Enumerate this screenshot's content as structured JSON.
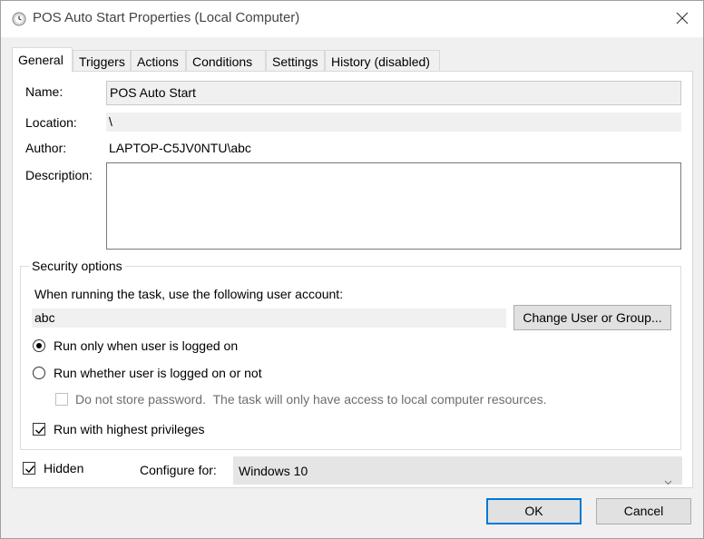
{
  "window": {
    "title": "POS Auto Start Properties (Local Computer)",
    "icon": "task-scheduler-clock-icon",
    "close_icon": "close-icon"
  },
  "tabs": [
    {
      "label": "General",
      "active": true
    },
    {
      "label": "Triggers"
    },
    {
      "label": "Actions"
    },
    {
      "label": "Conditions"
    },
    {
      "label": "Settings"
    },
    {
      "label": "History (disabled)"
    }
  ],
  "general": {
    "name_label": "Name:",
    "name_value": "POS Auto Start",
    "location_label": "Location:",
    "location_value": "\\",
    "author_label": "Author:",
    "author_value": "LAPTOP-C5JV0NTU\\abc",
    "description_label": "Description:",
    "description_value": ""
  },
  "security": {
    "legend": "Security options",
    "account_prompt": "When running the task, use the following user account:",
    "account_value": "abc",
    "change_button": "Change User or Group...",
    "radio_logged_on": {
      "label": "Run only when user is logged on",
      "selected": true
    },
    "radio_whether": {
      "label": "Run whether user is logged on or not",
      "selected": false
    },
    "no_store_password": {
      "label": "Do not store password.  The task will only have access to local computer resources.",
      "checked": false,
      "enabled": false
    },
    "highest_privileges": {
      "label": "Run with highest privileges",
      "checked": true
    }
  },
  "bottom": {
    "hidden": {
      "label": "Hidden",
      "checked": true
    },
    "configure_label": "Configure for:",
    "configure_value": "Windows 10"
  },
  "buttons": {
    "ok": "OK",
    "cancel": "Cancel"
  }
}
